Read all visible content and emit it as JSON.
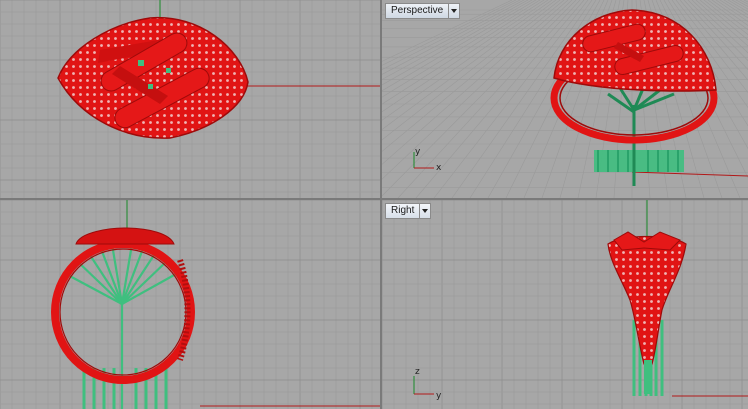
{
  "viewports": [
    {
      "id": "top",
      "label": "",
      "active": false
    },
    {
      "id": "perspective",
      "label": "Perspective",
      "active": false
    },
    {
      "id": "front",
      "label": "",
      "active": false
    },
    {
      "id": "right",
      "label": "Right",
      "active": true
    }
  ],
  "axes": {
    "perspective": {
      "a": "y",
      "b": "x"
    },
    "right": {
      "a": "z",
      "b": "y"
    }
  },
  "colors": {
    "viewport_bg": "#a7a7a7",
    "grid_minor": "#9c9c9c",
    "grid_major": "#8c8c8c",
    "x_axis": "#b11818",
    "y_axis": "#1a8a2a",
    "ring": "#e11414",
    "ring_dark": "#9e0a0a",
    "support": "#3fbf7f",
    "support_dark": "#1f8a55"
  }
}
